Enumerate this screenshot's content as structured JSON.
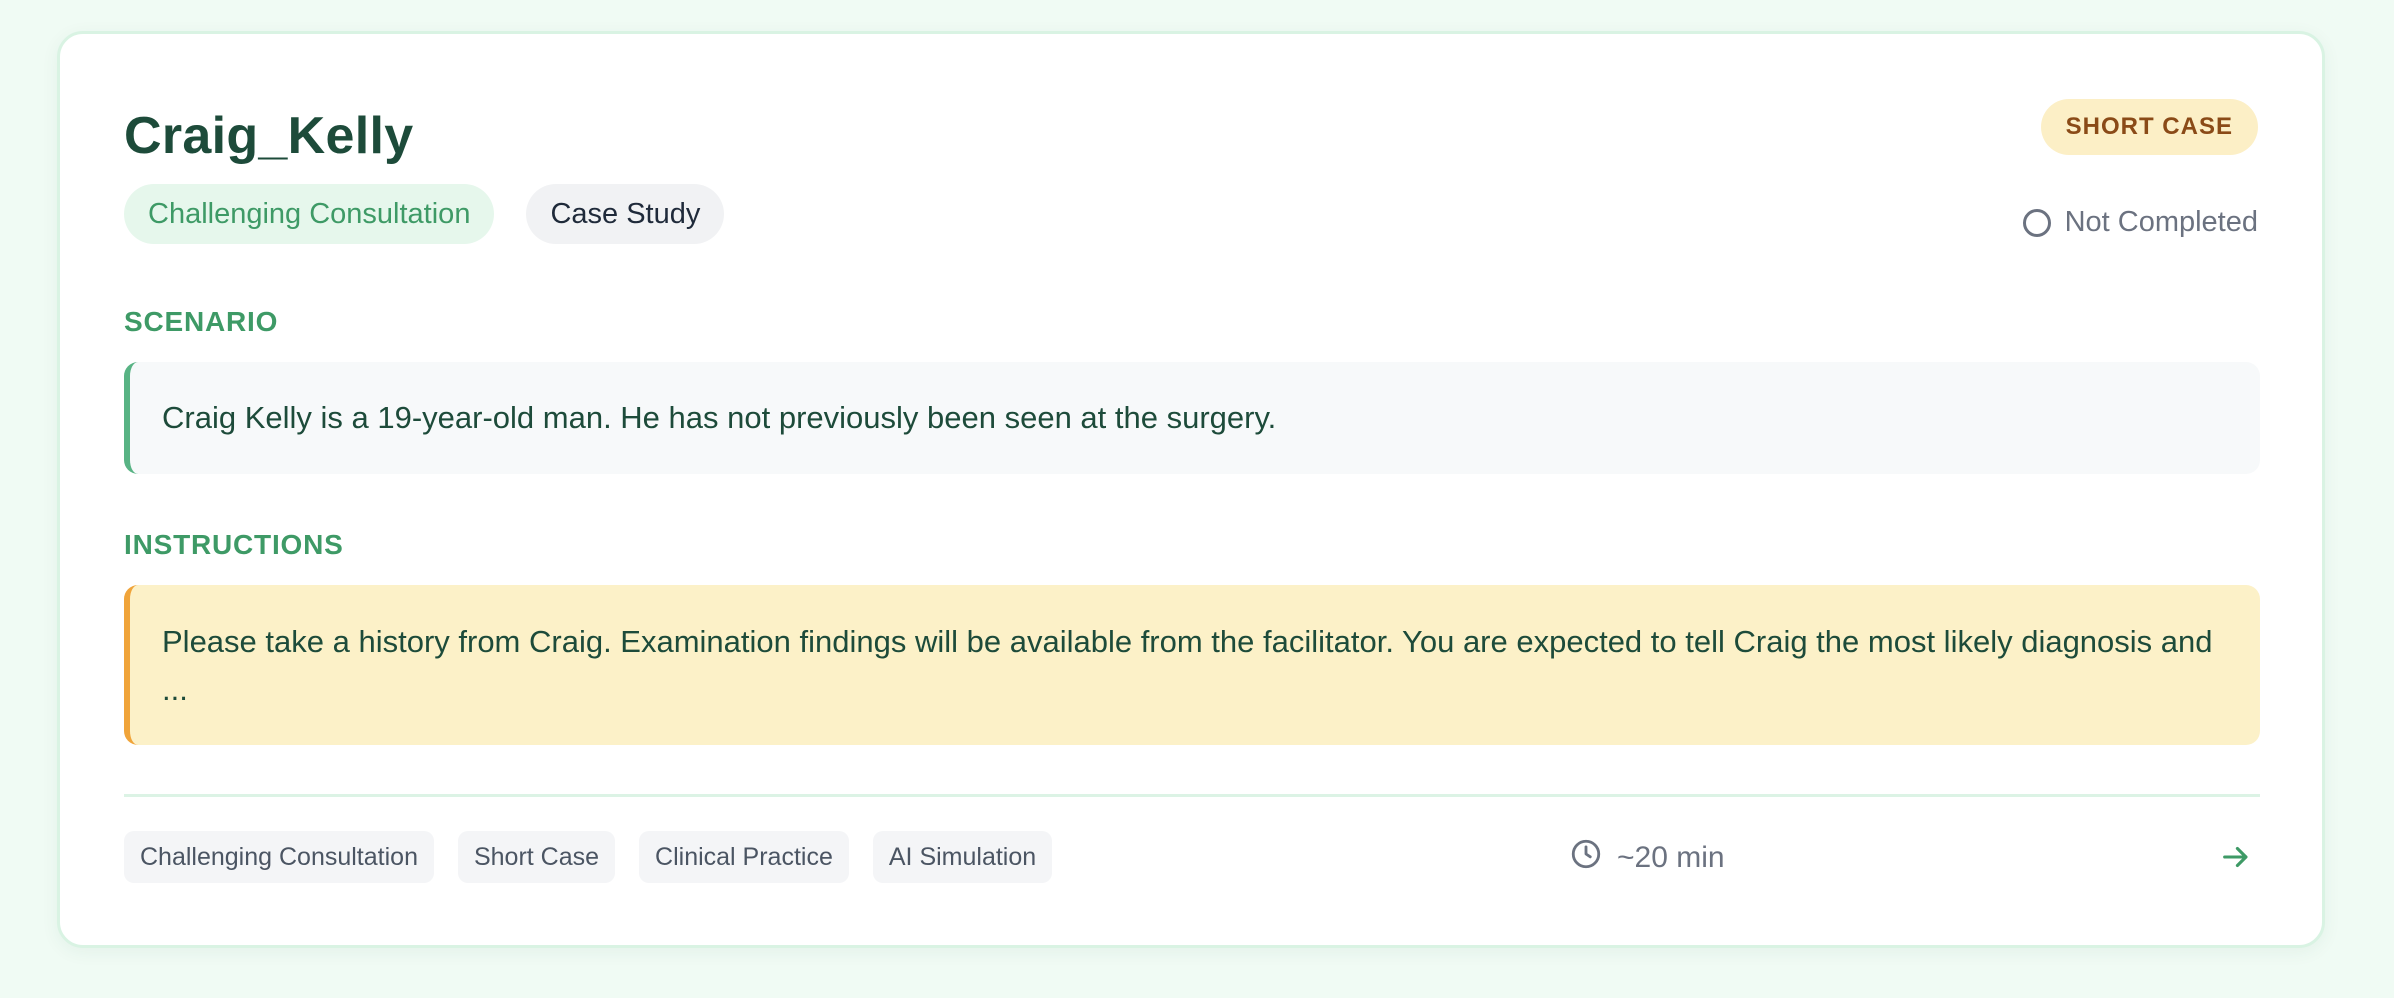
{
  "case": {
    "title": "Craig_Kelly",
    "type_badge": "SHORT CASE",
    "status": "Not Completed",
    "tags": [
      "Challenging Consultation",
      "Case Study"
    ]
  },
  "scenario": {
    "label": "SCENARIO",
    "text": "Craig Kelly is a 19-year-old man. He has not previously been seen at the surgery."
  },
  "instructions": {
    "label": "INSTRUCTIONS",
    "text": "Please take a history from Craig. Examination findings will be available from the facilitator. You are expected to tell Craig the most likely diagnosis and ..."
  },
  "footer": {
    "tags": [
      "Challenging Consultation",
      "Short Case",
      "Clinical Practice",
      "AI Simulation"
    ],
    "duration": "~20 min",
    "clock_icon": "clock-icon",
    "arrow_icon": "arrow-right-icon"
  },
  "colors": {
    "accent_green": "#3e9a66",
    "title_green": "#1d4b3a",
    "instructions_bg": "#fcf1c8",
    "instructions_border": "#f0a43a",
    "badge_bg": "#fcefc6",
    "badge_text": "#8a4a17"
  }
}
